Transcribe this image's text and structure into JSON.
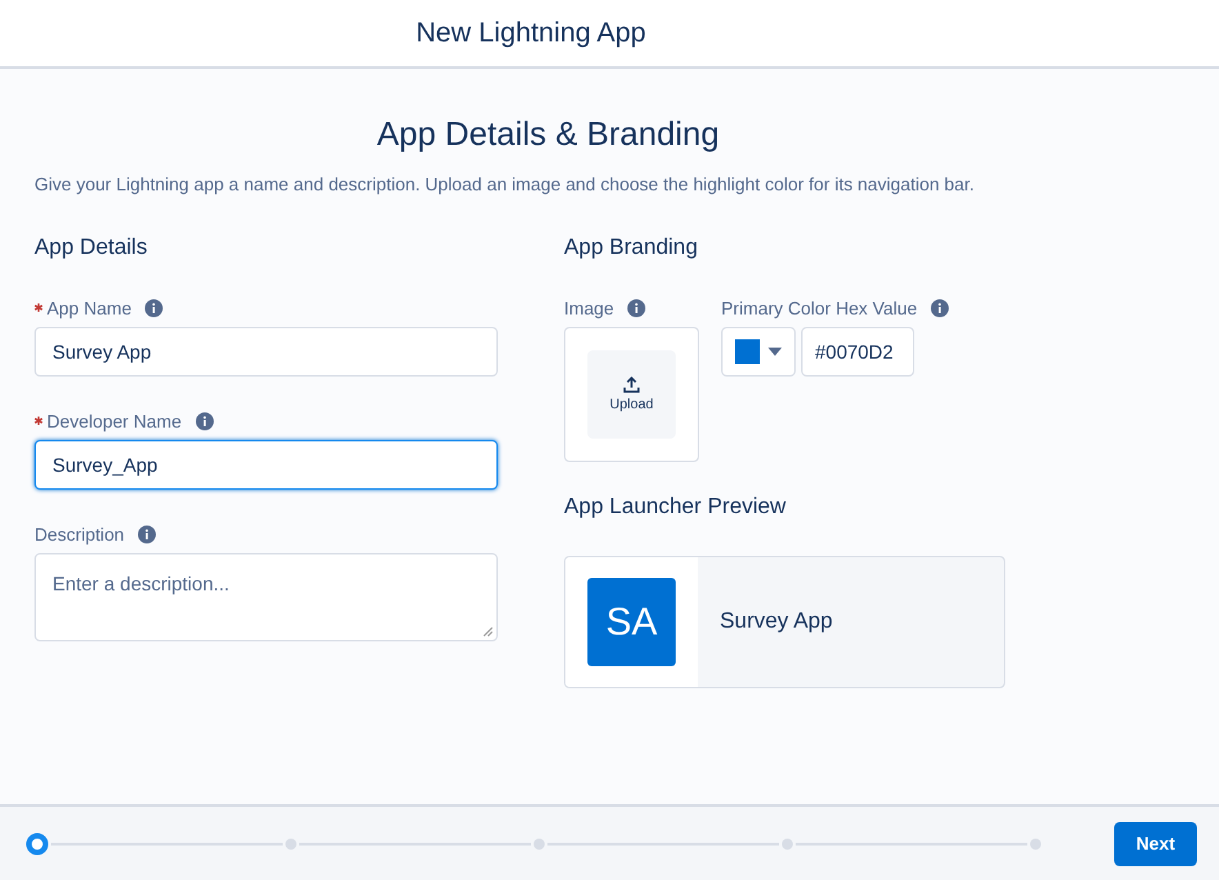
{
  "window": {
    "title": "New Lightning App"
  },
  "heading": "App Details & Branding",
  "intro": "Give your Lightning app a name and description. Upload an image and choose the highlight color for its navigation bar.",
  "details": {
    "title": "App Details",
    "fields": [
      {
        "label": "App Name",
        "required": true,
        "kind": "input",
        "value": "Survey App",
        "focused": false
      },
      {
        "label": "Developer Name",
        "required": true,
        "kind": "input",
        "value": "Survey_App",
        "focused": true
      },
      {
        "label": "Description",
        "required": false,
        "kind": "textarea",
        "placeholder": "Enter a description...",
        "focused": false
      }
    ]
  },
  "branding": {
    "title": "App Branding",
    "image_label": "Image",
    "upload": "Upload",
    "color_label": "Primary Color Hex Value",
    "color": "#0070d2",
    "hex_value": "#0070D2"
  },
  "preview": {
    "title": "App Launcher Preview",
    "initials": "SA",
    "name": "Survey App",
    "color": "#0070d2"
  },
  "steps": [
    {
      "selected": true
    },
    {
      "selected": false
    },
    {
      "selected": false
    },
    {
      "selected": false
    },
    {
      "selected": false
    }
  ],
  "next_button": "Next"
}
